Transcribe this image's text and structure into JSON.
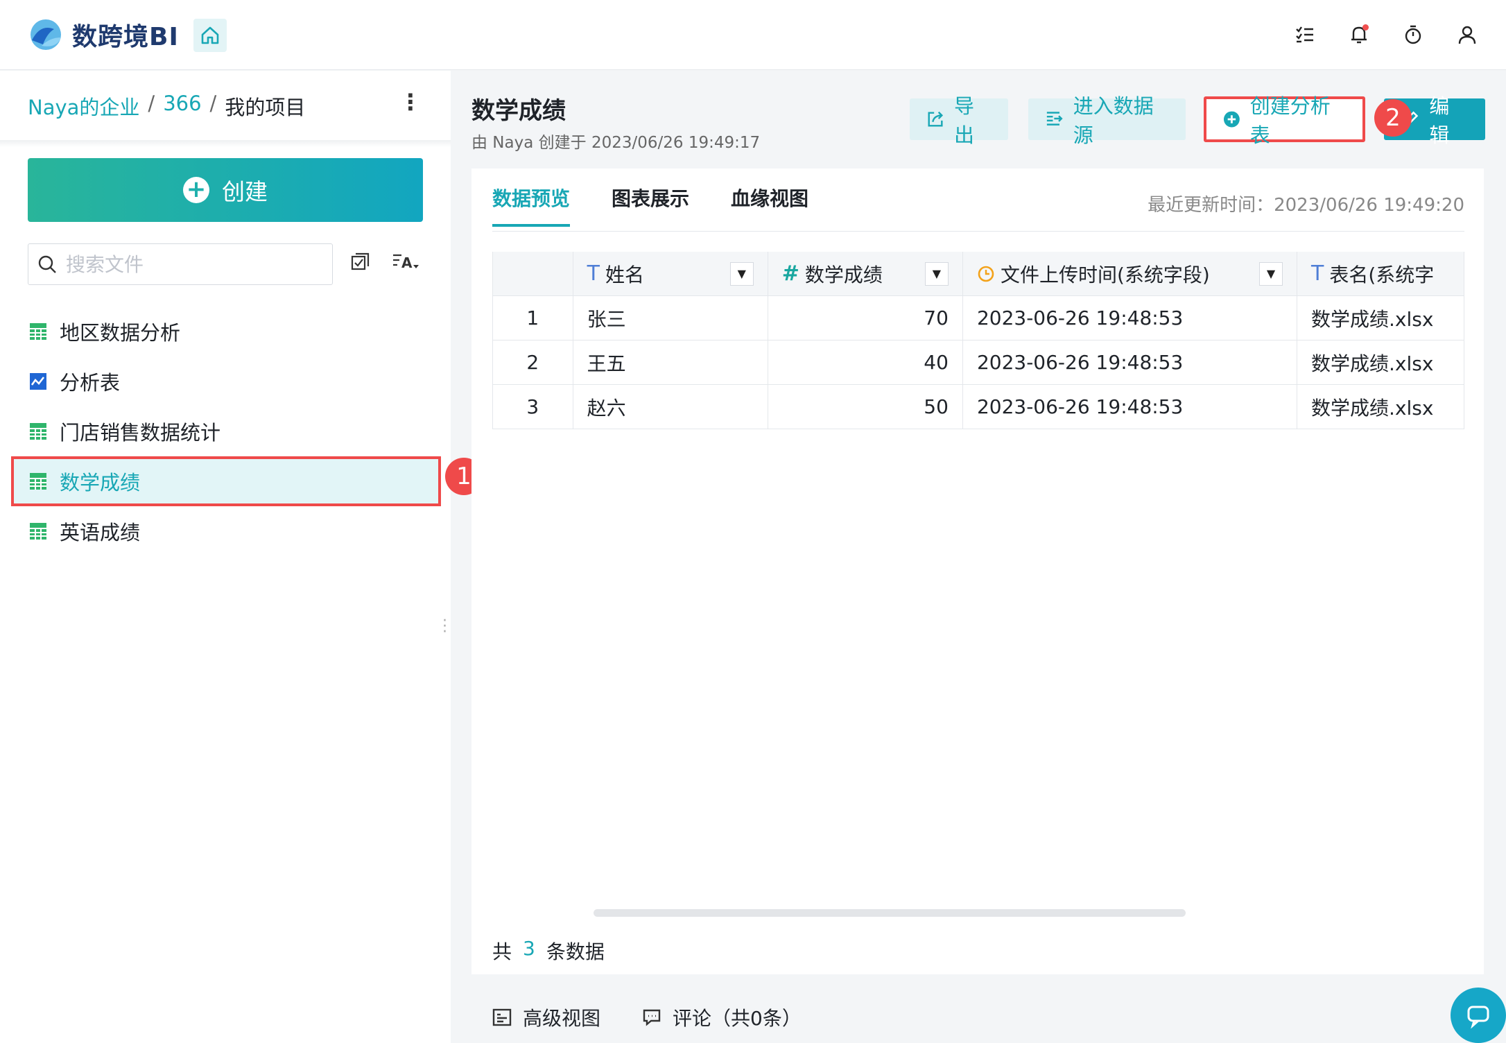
{
  "app": {
    "name": "数跨境BI"
  },
  "topbar": {
    "icons": [
      "home-icon",
      "task-list-icon",
      "bell-icon",
      "timer-icon",
      "user-icon"
    ]
  },
  "sidebar": {
    "breadcrumb": [
      "Naya的企业",
      "366",
      "我的项目"
    ],
    "breadcrumb_sep": "/",
    "more": "⋮",
    "create_label": "创建",
    "search_placeholder": "搜索文件",
    "files": [
      {
        "name": "地区数据分析",
        "icon": "table-icon"
      },
      {
        "name": "分析表",
        "icon": "chart-icon"
      },
      {
        "name": "门店销售数据统计",
        "icon": "table-icon"
      },
      {
        "name": "数学成绩",
        "icon": "table-icon"
      },
      {
        "name": "英语成绩",
        "icon": "table-icon"
      }
    ],
    "badge": "1"
  },
  "main": {
    "title": "数学成绩",
    "subtitle": "由 Naya 创建于 2023/06/26 19:49:17",
    "buttons": {
      "export": "导出",
      "datasource": "进入数据源",
      "create_analysis": "创建分析表",
      "edit": "编辑"
    },
    "badge": "2",
    "tabs": [
      "数据预览",
      "图表展示",
      "血缘视图"
    ],
    "updated": "最近更新时间：2023/06/26 19:49:20",
    "columns": [
      {
        "label": "姓名",
        "type": "T"
      },
      {
        "label": "数学成绩",
        "type": "#"
      },
      {
        "label": "文件上传时间(系统字段)",
        "type": "clock"
      },
      {
        "label": "表名(系统字",
        "type": "T"
      }
    ],
    "rows": [
      [
        "1",
        "张三",
        "70",
        "2023-06-26 19:48:53",
        "数学成绩.xlsx"
      ],
      [
        "2",
        "王五",
        "40",
        "2023-06-26 19:48:53",
        "数学成绩.xlsx"
      ],
      [
        "3",
        "赵六",
        "50",
        "2023-06-26 19:48:53",
        "数学成绩.xlsx"
      ]
    ],
    "count": {
      "prefix": "共",
      "n": "3",
      "suffix": "条数据"
    },
    "bottom": {
      "advanced": "高级视图",
      "comments": "评论（共0条）"
    }
  },
  "colors": {
    "accent": "#18a7b5",
    "highlight": "#ef4a4a"
  }
}
